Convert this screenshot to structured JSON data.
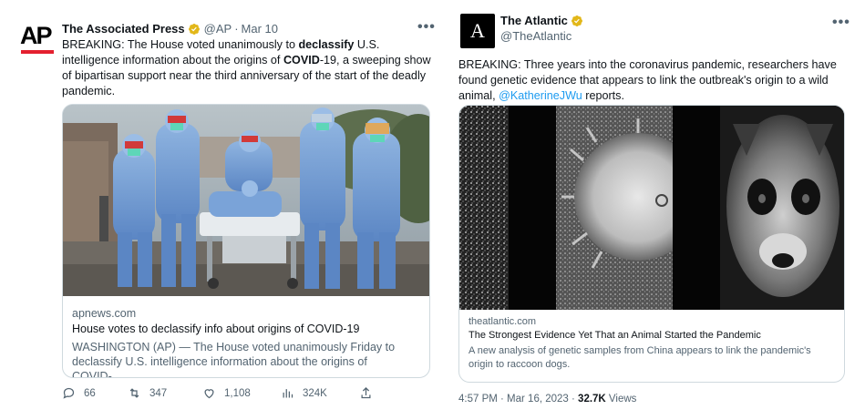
{
  "left_tweet": {
    "author_name": "The Associated Press",
    "handle": "@AP",
    "date": "Mar 10",
    "more_label": "•••",
    "logo_text": "AP",
    "text_parts": {
      "p1": "BREAKING: The House voted unanimously to ",
      "b1": "declassify",
      "p2": " U.S. intelligence information about the origins of ",
      "b2": "COVID",
      "p3": "-19, a sweeping show of bipartisan support near the third anniversary of the start of the deadly pandemic."
    },
    "card": {
      "domain": "apnews.com",
      "title": "House votes to declassify info about origins of COVID-19",
      "description": "WASHINGTON (AP) — The House voted unanimously Friday to declassify U.S. intelligence information about the origins of COVID-…"
    },
    "actions": {
      "replies": "66",
      "retweets": "347",
      "likes": "1,108",
      "views": "324K"
    }
  },
  "right_tweet": {
    "author_name": "The Atlantic",
    "handle": "@TheAtlantic",
    "more_label": "•••",
    "logo_text": "A",
    "text_before": "BREAKING: Three years into the coronavirus pandemic, researchers have found genetic evidence that appears to link the outbreak's origin to a wild animal, ",
    "mention": "@KatherineJWu",
    "text_after": " reports.",
    "card": {
      "domain": "theatlantic.com",
      "title": "The Strongest Evidence Yet That an Animal Started the Pandemic",
      "description": "A new analysis of genetic samples from China appears to link the pandemic's origin to raccoon dogs."
    },
    "meta": {
      "time": "4:57 PM · Mar 16, 2023 · ",
      "views_count": "32.7K",
      "views_label": " Views"
    }
  },
  "colors": {
    "verified_gold": "#e2b719",
    "link_blue": "#1d9bf0",
    "secondary_text": "#536471",
    "ap_red": "#e4202f"
  }
}
